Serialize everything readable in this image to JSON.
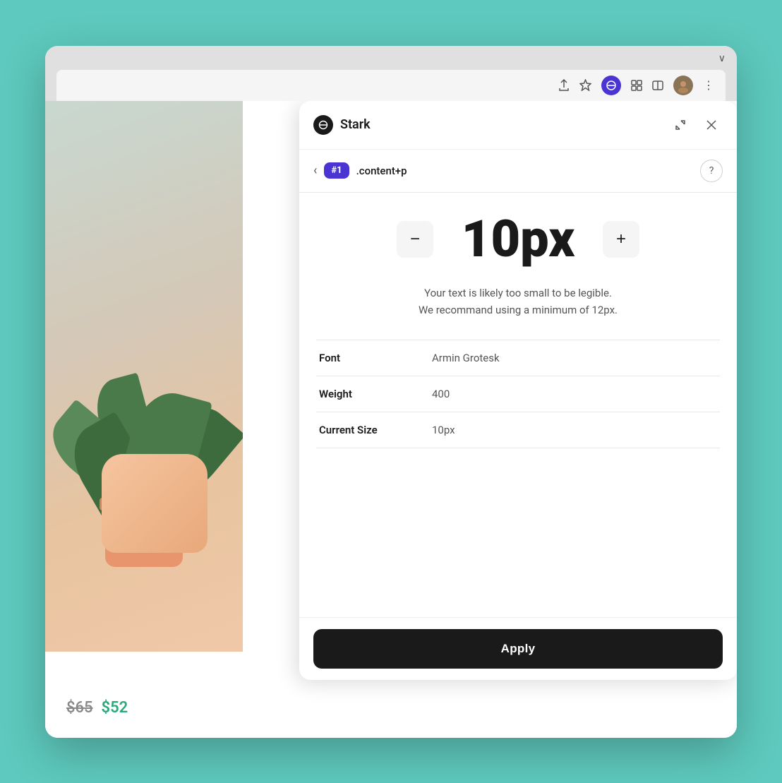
{
  "browser": {
    "chevron": "∨",
    "toolbar": {
      "share_icon": "↑",
      "star_icon": "☆",
      "stark_icon": "S",
      "puzzle_icon": "⊞",
      "window_icon": "▭",
      "more_icon": "⋮"
    }
  },
  "webpage": {
    "price_old": "$65",
    "price_new": "$52"
  },
  "stark_panel": {
    "brand": "Stark",
    "minimize_icon": "⤡",
    "close_icon": "✕",
    "back_icon": "‹",
    "issue_badge": "#1",
    "selector": ".content+p",
    "help_icon": "?",
    "font_size_value": "10px",
    "decrease_label": "−",
    "increase_label": "+",
    "warning_text": "Your text is likely too small to be legible.\nWe recommand using a minimum of 12px.",
    "details": [
      {
        "label": "Font",
        "value": "Armin Grotesk"
      },
      {
        "label": "Weight",
        "value": "400"
      },
      {
        "label": "Current Size",
        "value": "10px"
      }
    ],
    "apply_button_label": "Apply"
  }
}
